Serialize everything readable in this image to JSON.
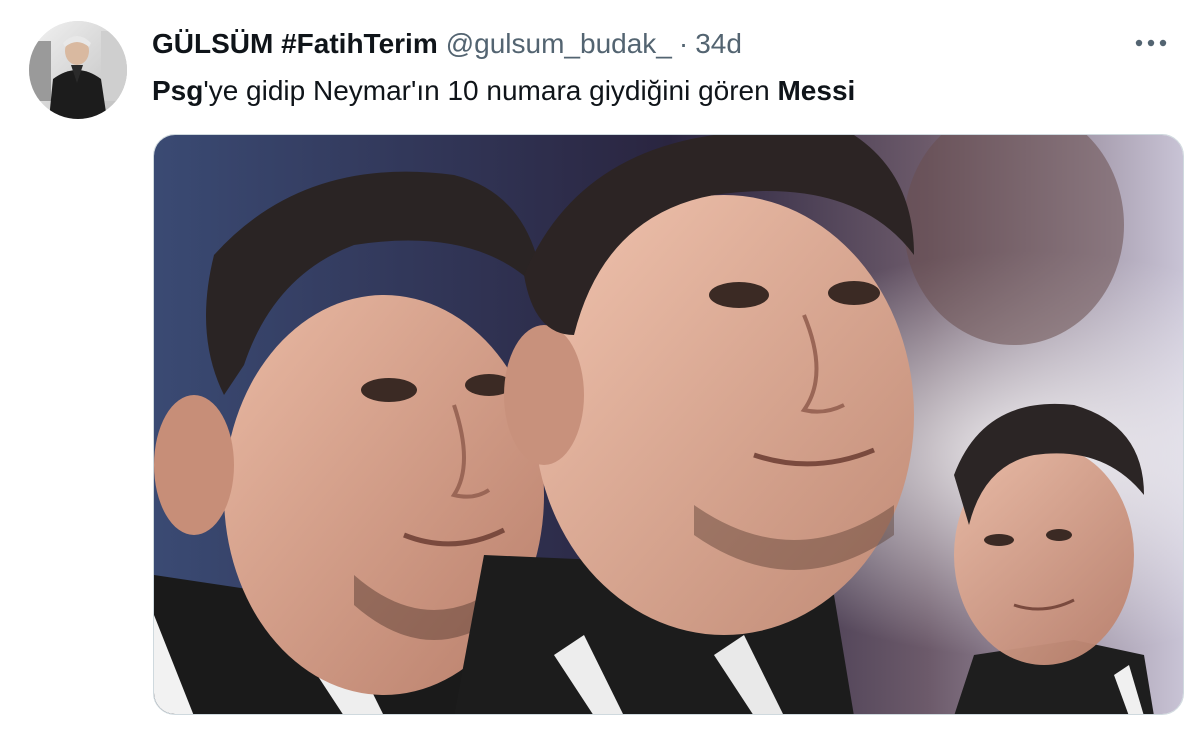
{
  "tweet": {
    "display_name": "GÜLSÜM #FatihTerim",
    "handle": "@gulsum_budak_",
    "separator": "·",
    "time": "34d",
    "text_parts": {
      "bold_1": "Psg",
      "middle": "'ye gidip Neymar'ın 10 numara giydiğini gören ",
      "bold_2": "Messi"
    }
  },
  "icons": {
    "more": "more-options-icon"
  },
  "media": {
    "description_icon": "photo-image"
  }
}
